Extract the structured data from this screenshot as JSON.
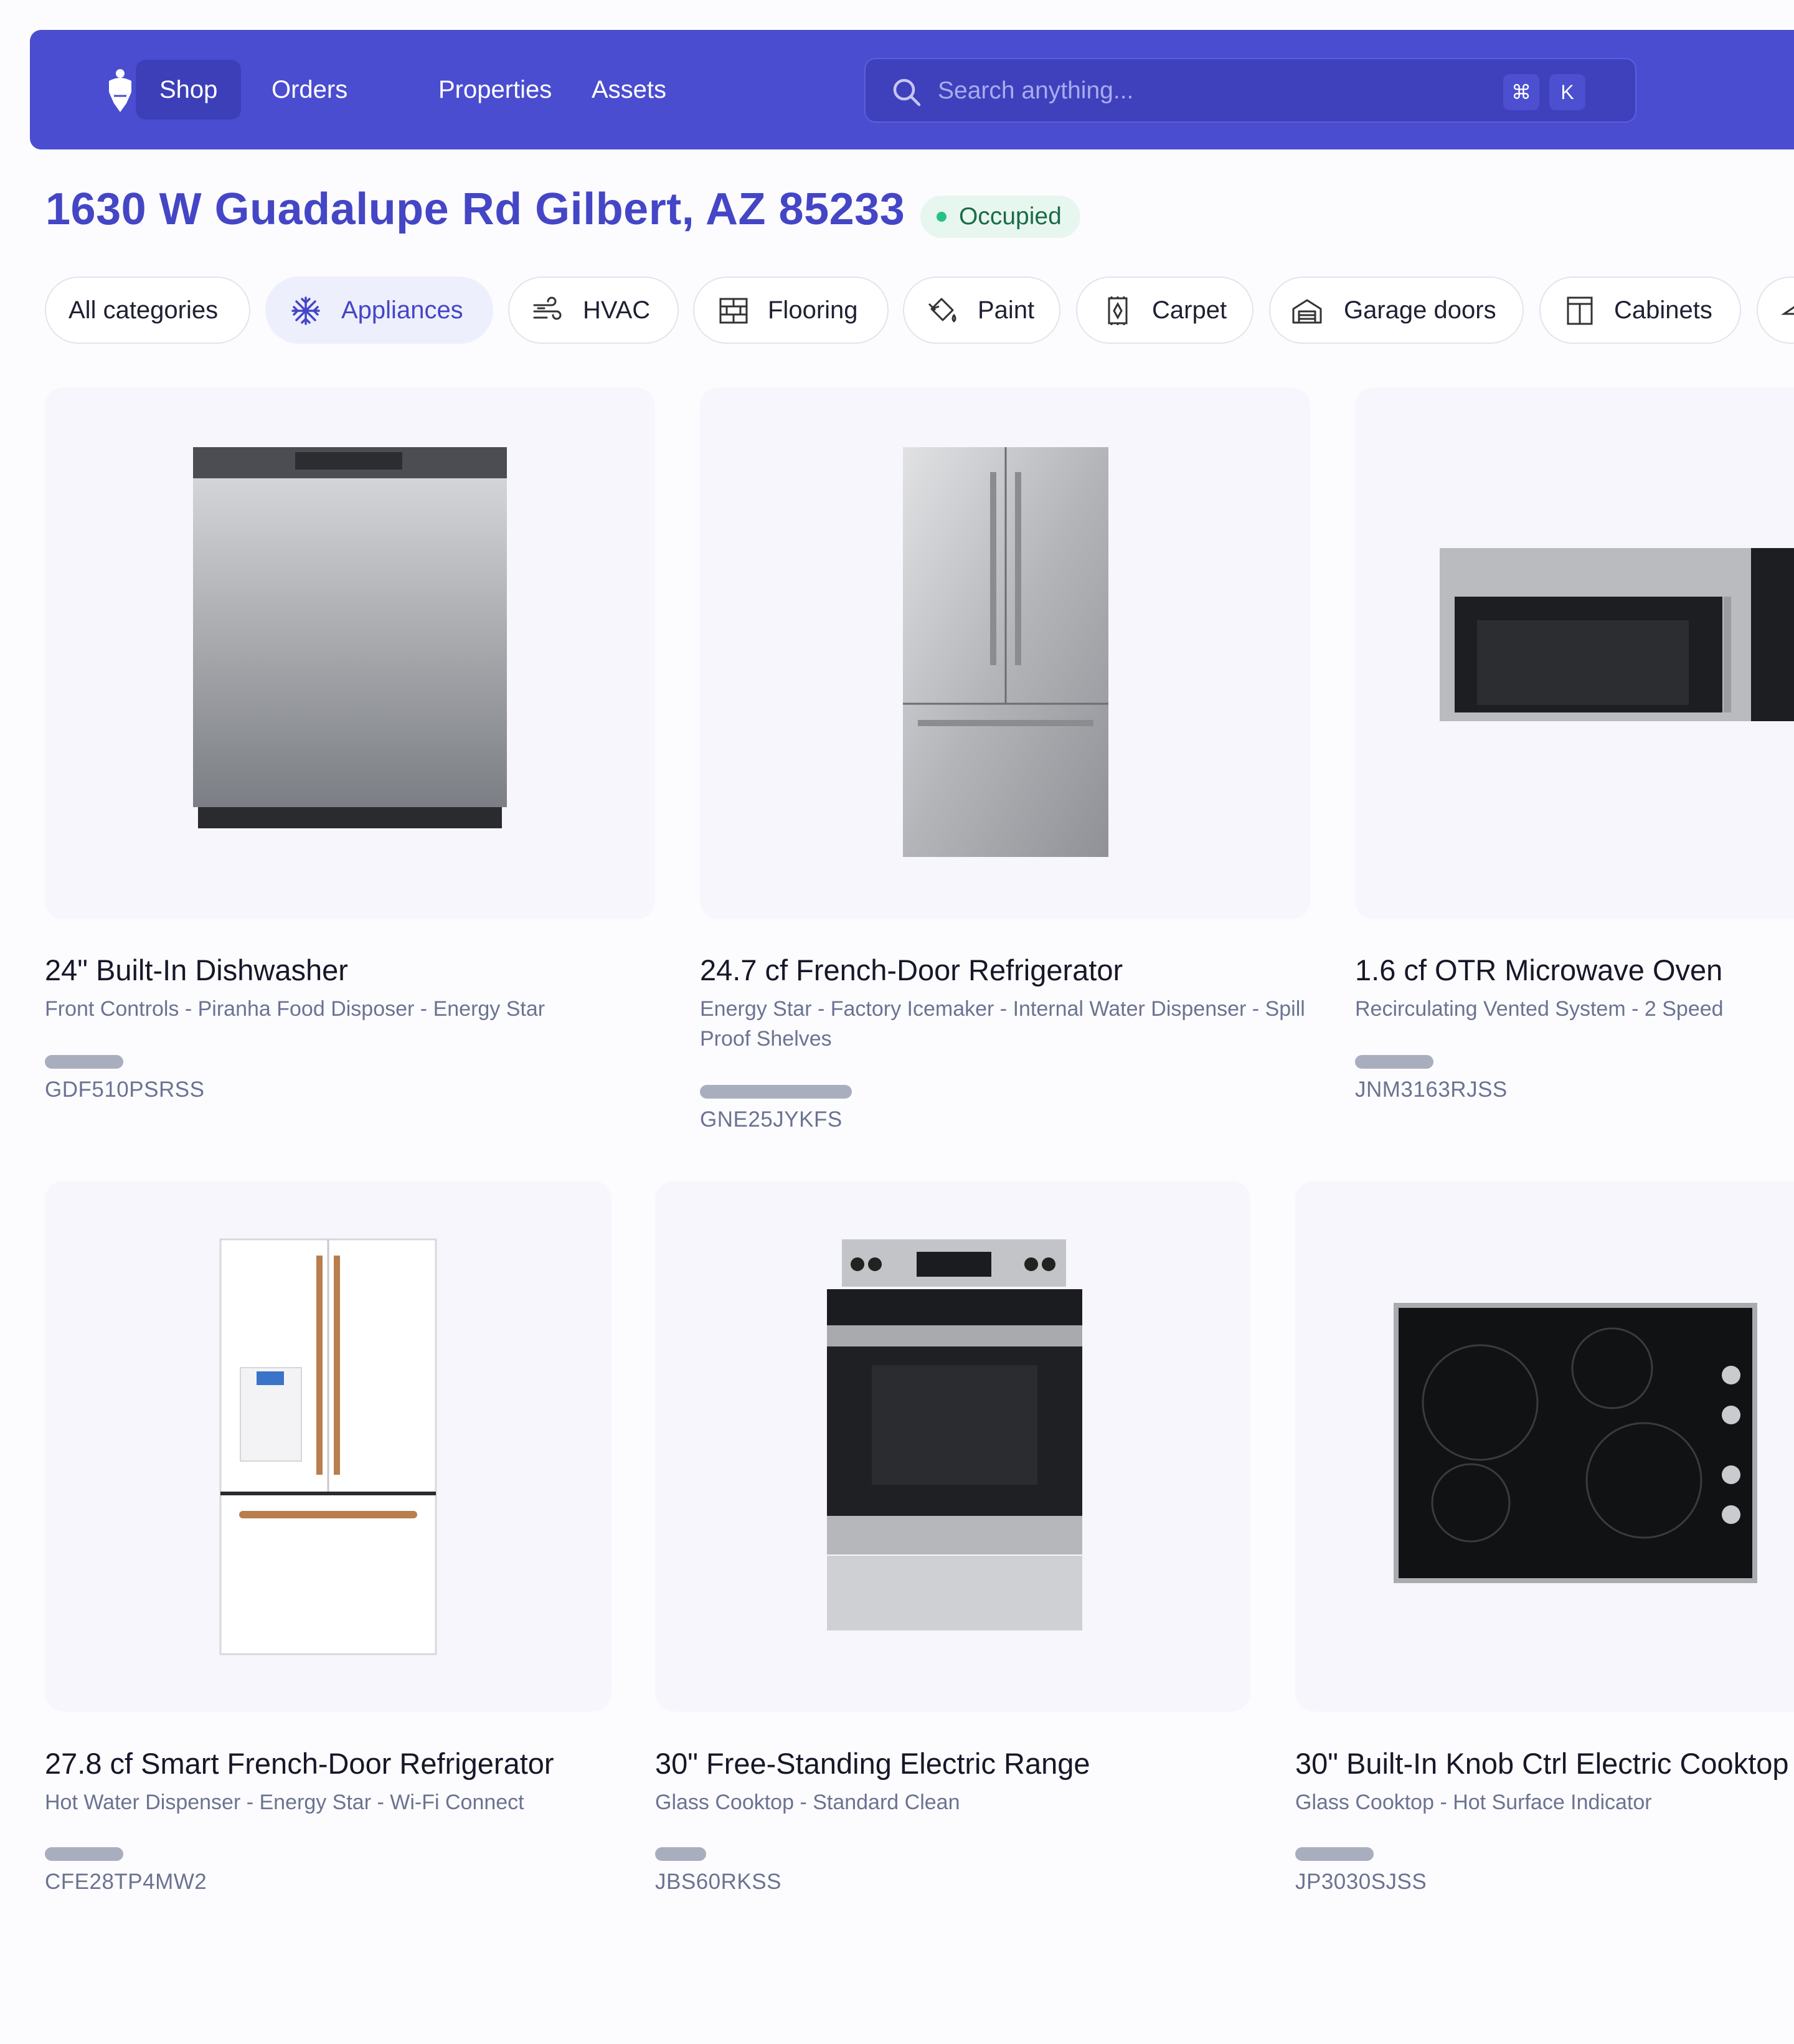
{
  "nav": {
    "links": [
      "Shop",
      "Orders",
      "Properties",
      "Assets"
    ],
    "active": "Shop",
    "search_placeholder": "Search anything...",
    "shortcut_keys": [
      "⌘",
      "K"
    ]
  },
  "property": {
    "address": "1630 W Guadalupe Rd Gilbert, AZ 85233",
    "status": "Occupied"
  },
  "categories": [
    {
      "label": "All categories",
      "icon": "none"
    },
    {
      "label": "Appliances",
      "icon": "snowflake-icon",
      "active": true
    },
    {
      "label": "HVAC",
      "icon": "wind-icon"
    },
    {
      "label": "Flooring",
      "icon": "brick-icon"
    },
    {
      "label": "Paint",
      "icon": "paint-bucket-icon"
    },
    {
      "label": "Carpet",
      "icon": "carpet-icon"
    },
    {
      "label": "Garage doors",
      "icon": "garage-icon"
    },
    {
      "label": "Cabinets",
      "icon": "cabinet-icon"
    }
  ],
  "products": [
    {
      "title": "24\" Built-In Dishwasher",
      "features": "Front Controls - Piranha Food Disposer - Energy Star",
      "sku": "GDF510PSRSS"
    },
    {
      "title": "24.7 cf French-Door Refrigerator",
      "features": "Energy Star - Factory Icemaker - Internal Water Dispenser - Spill Proof Shelves",
      "sku": "GNE25JYKFS"
    },
    {
      "title": "1.6 cf OTR Microwave Oven",
      "features": "Recirculating Vented System - 2 Speed",
      "sku": "JNM3163RJSS"
    },
    {
      "title": "27.8 cf Smart French-Door Refrigerator",
      "features": "Hot Water Dispenser - Energy Star - Wi-Fi Connect",
      "sku": "CFE28TP4MW2"
    },
    {
      "title": "30\" Free-Standing Electric Range",
      "features": "Glass Cooktop - Standard Clean",
      "sku": "JBS60RKSS"
    },
    {
      "title": "30\" Built-In Knob Ctrl Electric Cooktop",
      "features": "Glass Cooktop - Hot Surface Indicator",
      "sku": "JP3030SJSS"
    }
  ],
  "colors": {
    "brand": "#4a4dd0",
    "title": "#4446c6",
    "status_bg": "#e7f7ef",
    "status_dot": "#27c184"
  }
}
